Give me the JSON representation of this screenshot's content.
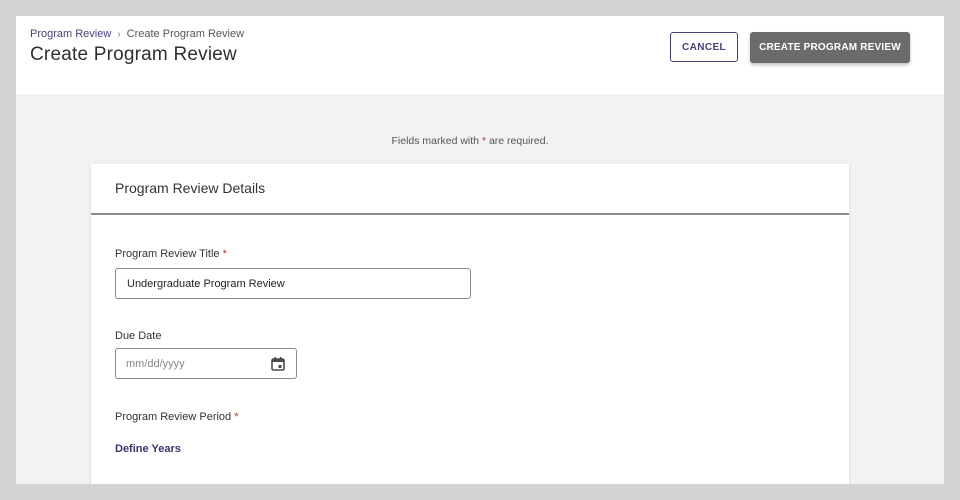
{
  "header": {
    "breadcrumb": {
      "parent": "Program Review",
      "separator": "›",
      "current": "Create Program Review"
    },
    "title": "Create Program Review",
    "cancel_label": "CANCEL",
    "create_label": "CREATE PROGRAM REVIEW"
  },
  "form": {
    "required_note_prefix": "Fields marked with",
    "required_note_asterisk": "*",
    "required_note_suffix": "are required.",
    "card_title": "Program Review Details",
    "title_field": {
      "label": "Program Review Title",
      "required_mark": "*",
      "value": "Undergraduate Program Review"
    },
    "due_date": {
      "label": "Due Date",
      "placeholder": "mm/dd/yyyy",
      "icon": "calendar-icon"
    },
    "period": {
      "label": "Program Review Period",
      "required_mark": "*",
      "link": "Define Years"
    }
  },
  "colors": {
    "accent": "#4a3d7a",
    "primary_button": "#6b6b6b",
    "required": "#c0392b",
    "background": "#f2f2f2"
  }
}
